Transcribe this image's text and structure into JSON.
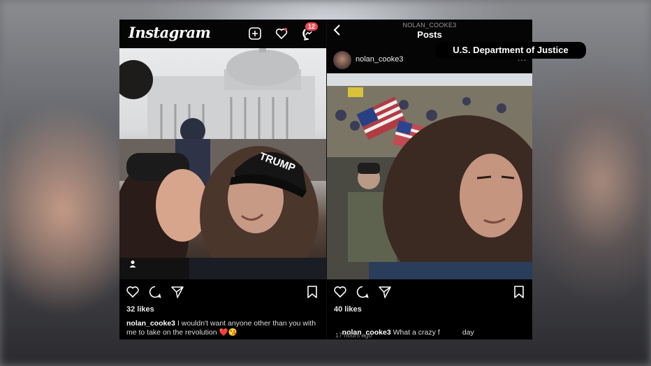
{
  "left_post": {
    "app_logo": "Instagram",
    "notification_count": "12",
    "likes": "32 likes",
    "username": "nolan_cooke3",
    "caption": "I wouldn't want anyone other than you with me to take on the revolution",
    "caption_emoji": "❤️😘",
    "cap_text": "TRUMP"
  },
  "right_post": {
    "header_username": "NOLAN_COOKE3",
    "header_title": "Posts",
    "post_username": "nolan_cooke3",
    "more_label": "...",
    "likes": "40 likes",
    "username": "nolan_cooke3",
    "caption": "What a crazy f           day",
    "timestamp": "17 hours ago"
  },
  "overlay": {
    "source_label": "U.S. Department of Justice"
  },
  "icons": {
    "left_header": [
      "add-post-icon",
      "heart-icon",
      "messenger-icon"
    ],
    "actions": [
      "like-icon",
      "comment-icon",
      "share-icon",
      "save-icon"
    ],
    "right_header": [
      "back-icon"
    ]
  },
  "colors": {
    "panel_bg": "#000000",
    "badge": "#ed4956",
    "text": "#ffffff"
  }
}
